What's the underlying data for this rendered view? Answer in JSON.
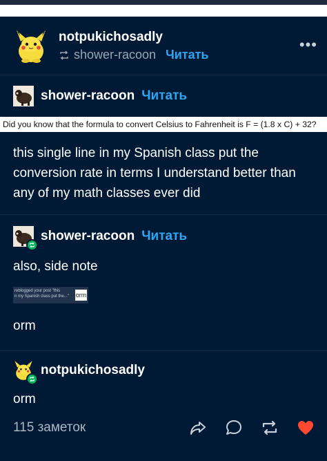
{
  "post": {
    "author": "notpukichosadly",
    "reblogged_from": "shower-racoon",
    "follow_label": "Читать",
    "more_label": "•••"
  },
  "trail": [
    {
      "username": "shower-racoon",
      "follow_label": "Читать",
      "image_text": "Did you know that the formula to convert Celsius to Fahrenheit is F = (1.8 x C) + 32?",
      "text": "this single line in my Spanish class put the conversion rate in terms I understand better than any of my math classes ever did"
    },
    {
      "username": "shower-racoon",
      "follow_label": "Читать",
      "text": "also, side note",
      "notification": {
        "line1": "reblogged your post \"this",
        "line2": "n my Spanish class put the...\"",
        "box_text": "orm"
      },
      "text2": "orm"
    },
    {
      "username": "notpukichosadly",
      "text": "orm"
    }
  ],
  "footer": {
    "notes": "115 заметок",
    "icons": [
      "share-icon",
      "reply-icon",
      "reblog-icon",
      "like-icon"
    ],
    "like_color": "#ff4930"
  },
  "colors": {
    "background": "#001935",
    "accent": "#2fa6f2",
    "reblog_badge": "#00b85c"
  }
}
